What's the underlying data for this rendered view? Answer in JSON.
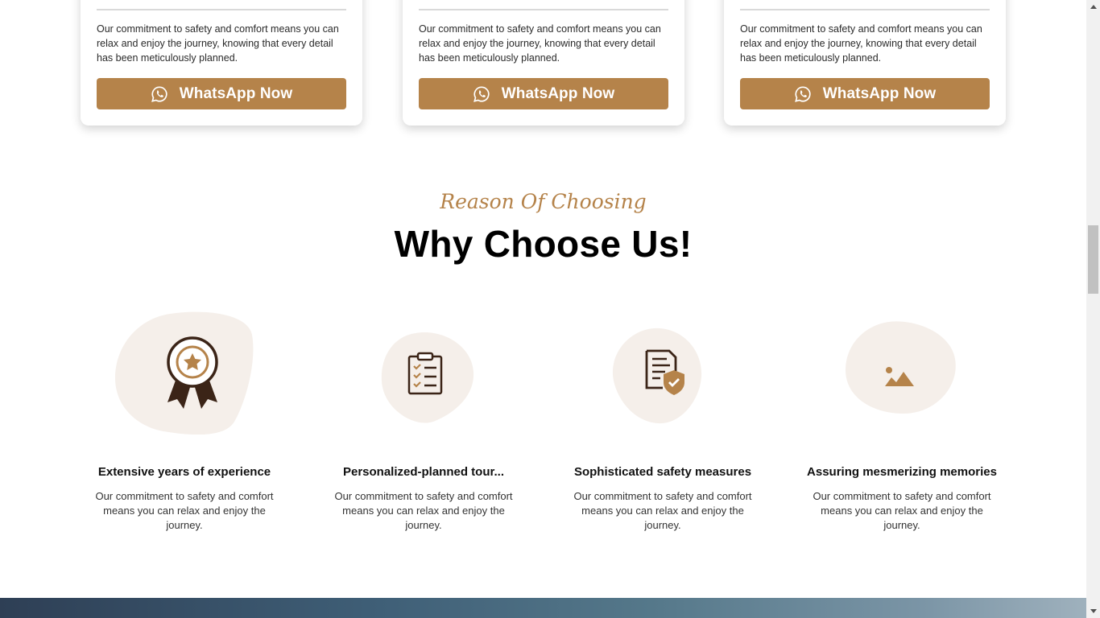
{
  "cards": [
    {
      "description": "Our commitment to safety and comfort means you can relax and enjoy the journey, knowing that every detail has been meticulously planned.",
      "button_label": "WhatsApp Now",
      "button_icon": "whatsapp-icon"
    },
    {
      "description": "Our commitment to safety and comfort means you can relax and enjoy the journey, knowing that every detail has been meticulously planned.",
      "button_label": "WhatsApp Now",
      "button_icon": "whatsapp-icon"
    },
    {
      "description": "Our commitment to safety and comfort means you can relax and enjoy the journey, knowing that every detail has been meticulously planned.",
      "button_label": "WhatsApp Now",
      "button_icon": "whatsapp-icon"
    }
  ],
  "why_section": {
    "kicker": "Reason Of Choosing",
    "heading": "Why Choose Us!"
  },
  "features": [
    {
      "icon": "award-ribbon-icon",
      "title": "Extensive years of experience",
      "text": "Our commitment to safety and comfort means you can relax and enjoy the journey."
    },
    {
      "icon": "clipboard-checklist-icon",
      "title": "Personalized-planned tour...",
      "text": "Our commitment to safety and comfort means you can relax and enjoy the journey."
    },
    {
      "icon": "document-shield-icon",
      "title": "Sophisticated safety measures",
      "text": "Our commitment to safety and comfort means you can relax and enjoy the journey."
    },
    {
      "icon": "image-placeholder-icon",
      "title": "Assuring mesmerizing memories",
      "text": "Our commitment to safety and comfort means you can relax and enjoy the journey."
    }
  ],
  "colors": {
    "accent": "#b5834a",
    "blob": "#f5efea",
    "icon_dark": "#3b2417"
  }
}
